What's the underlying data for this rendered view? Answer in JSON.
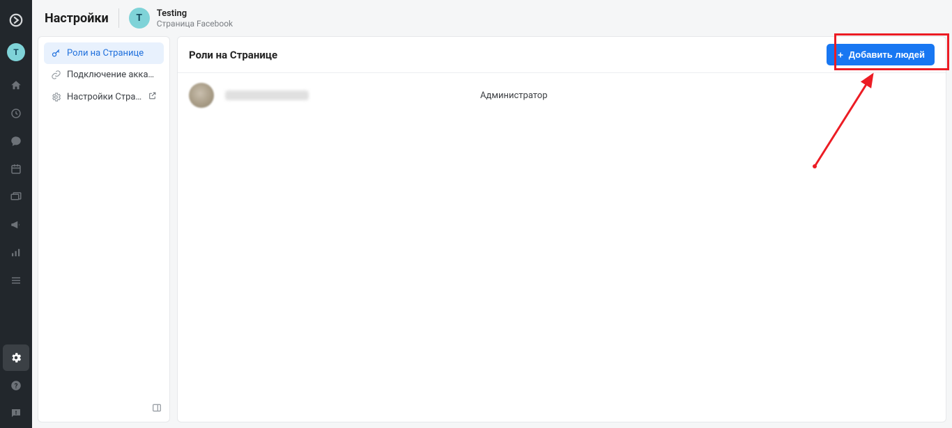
{
  "rail": {
    "avatar_initial": "T"
  },
  "topbar": {
    "title": "Настройки",
    "page_initial": "T",
    "page_name": "Testing",
    "page_sub": "Страница Facebook"
  },
  "sidebar": {
    "items": [
      {
        "label": "Роли на Странице"
      },
      {
        "label": "Подключение аккаунт..."
      },
      {
        "label": "Настройки Страни..."
      }
    ]
  },
  "panel": {
    "title": "Роли на Странице",
    "add_button_label": "Добавить людей",
    "members": [
      {
        "role": "Администратор"
      }
    ]
  }
}
